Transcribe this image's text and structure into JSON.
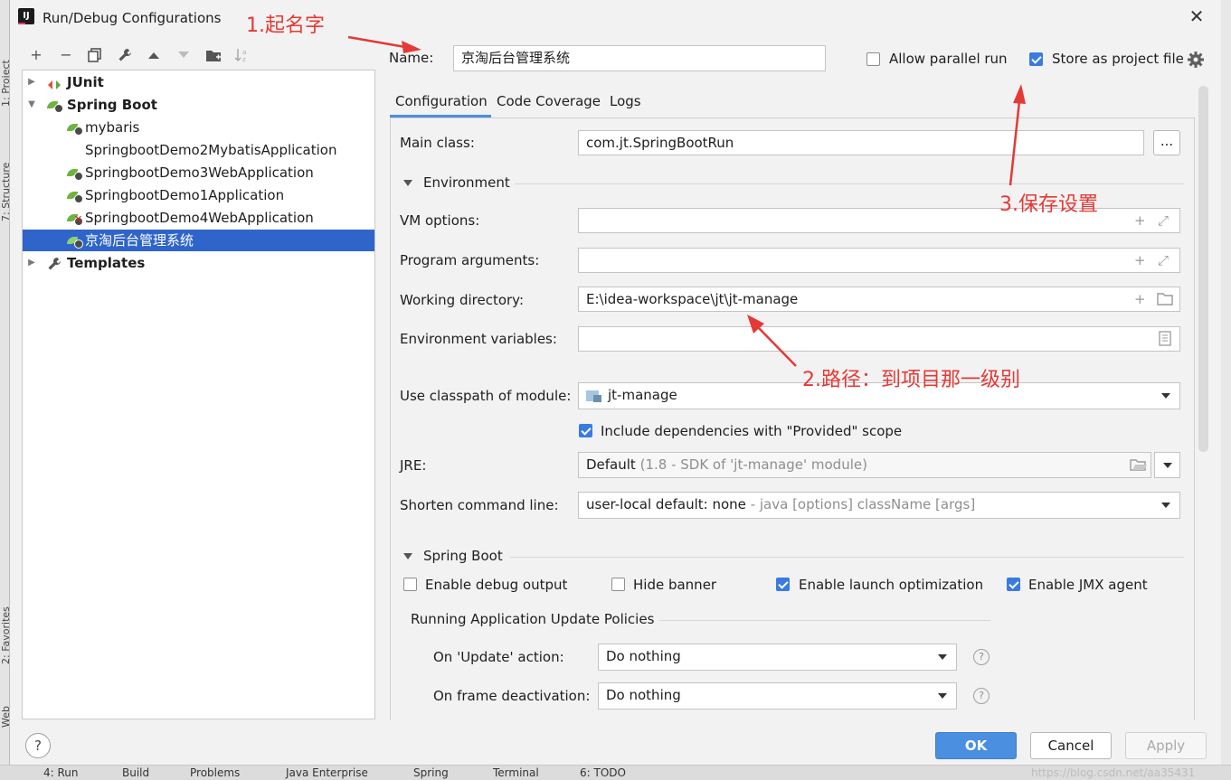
{
  "ide": {
    "side_labels": [
      "1: Project",
      "7: Structure",
      "2: Favorites",
      "Web"
    ],
    "bottom_tabs": [
      "4: Run",
      "Build",
      "Problems",
      "Java Enterprise",
      "Spring",
      "Terminal",
      "6: TODO"
    ],
    "watermark": "https://blog.csdn.net/aa35431"
  },
  "dialog": {
    "title": "Run/Debug Configurations",
    "app_icon": "IJ",
    "close_icon": "close-icon"
  },
  "toolbar": {
    "add": "+",
    "remove": "−",
    "copy": "⧉",
    "edit": "🔧",
    "up": "▲",
    "down": "▼",
    "folder": "📁",
    "sort": "↓a"
  },
  "tree": {
    "items": [
      {
        "label": "JUnit",
        "bold": true,
        "expanded": false
      },
      {
        "label": "Spring Boot",
        "bold": true,
        "expanded": true
      },
      {
        "label": "mybaris"
      },
      {
        "label": "SpringbootDemo2MybatisApplication"
      },
      {
        "label": "SpringbootDemo3WebApplication"
      },
      {
        "label": "SpringbootDemo1Application"
      },
      {
        "label": "SpringbootDemo4WebApplication",
        "error": true
      },
      {
        "label": "京淘后台管理系统",
        "selected": true
      },
      {
        "label": "Templates",
        "bold": true,
        "expanded": false
      }
    ]
  },
  "header": {
    "name_label": "Name:",
    "name_value": "京淘后台管理系统",
    "allow_parallel_label": "Allow parallel run",
    "allow_parallel_checked": false,
    "store_project_label": "Store as project file",
    "store_project_checked": true
  },
  "tabs": [
    "Configuration",
    "Code Coverage",
    "Logs"
  ],
  "form": {
    "main_class_label": "Main class:",
    "main_class_value": "com.jt.SpringBootRun",
    "browse_label": "...",
    "environment_section": "Environment",
    "vm_options_label": "VM options:",
    "vm_options_value": "",
    "program_args_label": "Program arguments:",
    "program_args_value": "",
    "working_dir_label": "Working directory:",
    "working_dir_value": "E:\\idea-workspace\\jt\\jt-manage",
    "env_vars_label": "Environment variables:",
    "env_vars_value": "",
    "classpath_label": "Use classpath of module:",
    "classpath_value": "jt-manage",
    "include_deps_label": "Include dependencies with \"Provided\" scope",
    "include_deps_checked": true,
    "jre_label": "JRE:",
    "jre_value": "Default",
    "jre_hint": "(1.8 - SDK of 'jt-manage' module)",
    "shorten_label": "Shorten command line:",
    "shorten_value": "user-local default: none",
    "shorten_hint": "- java [options] className [args]",
    "spring_boot_section": "Spring Boot",
    "enable_debug_label": "Enable debug output",
    "enable_debug_checked": false,
    "hide_banner_label": "Hide banner",
    "hide_banner_checked": false,
    "launch_opt_label": "Enable launch optimization",
    "launch_opt_checked": true,
    "jmx_label": "Enable JMX agent",
    "jmx_checked": true,
    "policies_title": "Running Application Update Policies",
    "on_update_label": "On 'Update' action:",
    "on_update_value": "Do nothing",
    "on_frame_label": "On frame deactivation:",
    "on_frame_value": "Do nothing"
  },
  "annotations": {
    "a1": "1.起名字",
    "a2": "2.路径：到项目那一级别",
    "a3": "3.保存设置"
  },
  "footer": {
    "help": "?",
    "ok": "OK",
    "cancel": "Cancel",
    "apply": "Apply"
  },
  "colors": {
    "accent": "#2f65ca",
    "primary_button": "#4a8fe0",
    "annotation": "#e53935",
    "spring_leaf": "#6db33f"
  }
}
